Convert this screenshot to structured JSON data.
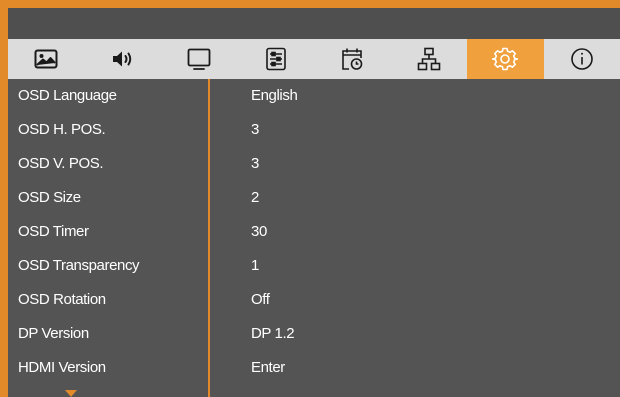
{
  "tabs": [
    {
      "name": "picture-icon",
      "active": false
    },
    {
      "name": "audio-icon",
      "active": false
    },
    {
      "name": "monitor-icon",
      "active": false
    },
    {
      "name": "adjustments-icon",
      "active": false
    },
    {
      "name": "schedule-icon",
      "active": false
    },
    {
      "name": "network-icon",
      "active": false
    },
    {
      "name": "settings-icon",
      "active": true
    },
    {
      "name": "info-icon",
      "active": false
    }
  ],
  "settings": [
    {
      "label": "OSD Language",
      "value": "English"
    },
    {
      "label": "OSD H. POS.",
      "value": "3"
    },
    {
      "label": "OSD V. POS.",
      "value": "3"
    },
    {
      "label": "OSD Size",
      "value": "2"
    },
    {
      "label": "OSD Timer",
      "value": "30"
    },
    {
      "label": "OSD Transparency",
      "value": "1"
    },
    {
      "label": "OSD Rotation",
      "value": "Off"
    },
    {
      "label": "DP Version",
      "value": "DP 1.2"
    },
    {
      "label": "HDMI Version",
      "value": "Enter"
    }
  ],
  "colors": {
    "accent": "#e28a2a",
    "active_tab": "#f0a03c",
    "panel": "#545454",
    "tab_bar": "#dcdcdc",
    "text": "#ffffff"
  }
}
